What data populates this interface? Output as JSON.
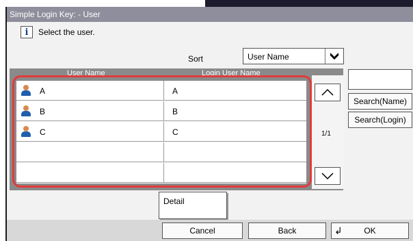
{
  "window": {
    "title": "Simple Login Key:  - User"
  },
  "prompt": {
    "text": "Select the user."
  },
  "sort": {
    "label": "Sort",
    "selected": "User Name"
  },
  "table": {
    "columns": [
      "User Name",
      "Login User Name"
    ],
    "rows": [
      {
        "name": "A",
        "login": "A"
      },
      {
        "name": "B",
        "login": "B"
      },
      {
        "name": "C",
        "login": "C"
      },
      {
        "name": "",
        "login": ""
      },
      {
        "name": "",
        "login": ""
      }
    ],
    "page": "1/1"
  },
  "search": {
    "name_label": "Search(Name)",
    "login_label": "Search(Login)"
  },
  "buttons": {
    "detail": "Detail",
    "cancel": "Cancel",
    "back": "Back",
    "ok": "OK"
  },
  "colors": {
    "highlight": "#e23a3a",
    "title_bar": "#8e8e9c",
    "icon_blue": "#1f5fae"
  }
}
